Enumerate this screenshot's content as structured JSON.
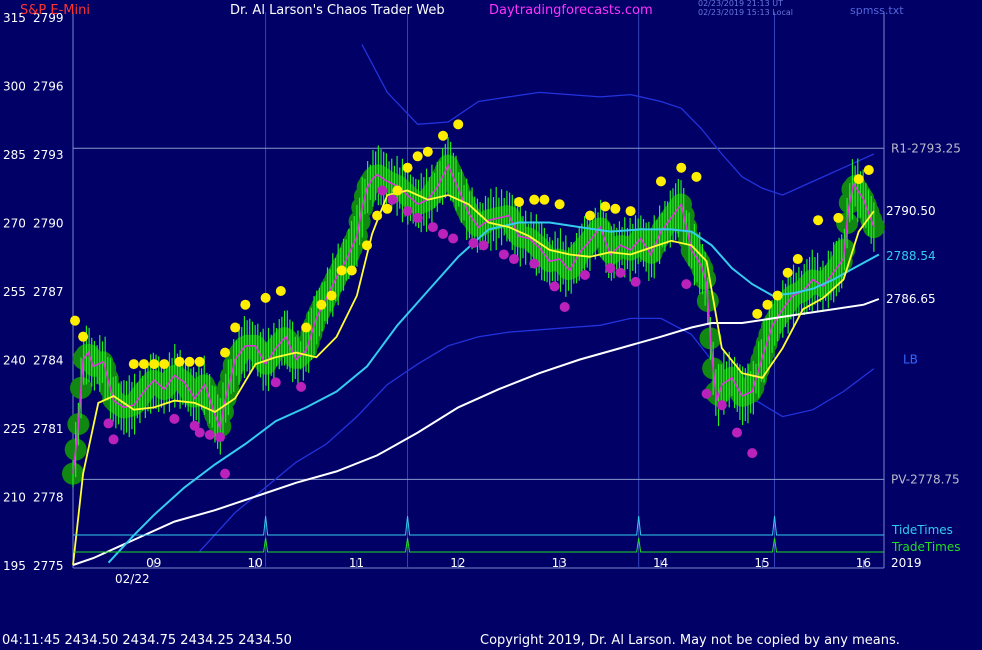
{
  "header": {
    "symbol_label": "S&P E-Mini",
    "title": "Dr. Al Larson's Chaos Trader Web",
    "site": "Daytradingforecasts.com",
    "stamp_ut": "02/23/2019 21:13 UT",
    "stamp_local": "02/23/2019 15:13 Local",
    "file": "spmss.txt"
  },
  "footer": {
    "quote": "04:11:45  2434.50  2434.75  2434.25  2434.50",
    "copyright": "Copyright 2019, Dr. Al Larson. May not be copied by any means."
  },
  "colors": {
    "background": "#000066",
    "price_bars": "#22ee22",
    "halo": "#118811",
    "price_smooth": "#ffff33",
    "cyan_avg": "#33ccee",
    "white_avg": "#ffffff",
    "channel": "#2233dd",
    "pivot_lines": "#8899cc",
    "highs_dots": "#ffee00",
    "lows_dots": "#bb22bb",
    "tide": "#33ccee",
    "trade": "#22dd22"
  },
  "chart_data": {
    "type": "line",
    "ylim": [
      2775,
      2799
    ],
    "left_axis": [
      {
        "idx": "315",
        "price": "2799",
        "value": 2799
      },
      {
        "idx": "300",
        "price": "2796",
        "value": 2796
      },
      {
        "idx": "285",
        "price": "2793",
        "value": 2793
      },
      {
        "idx": "270",
        "price": "2790",
        "value": 2790
      },
      {
        "idx": "255",
        "price": "2787",
        "value": 2787
      },
      {
        "idx": "240",
        "price": "2784",
        "value": 2784
      },
      {
        "idx": "225",
        "price": "2781",
        "value": 2781
      },
      {
        "idx": "210",
        "price": "2778",
        "value": 2778
      },
      {
        "idx": "195",
        "price": "2775",
        "value": 2775
      }
    ],
    "x_ticks": [
      {
        "label": "09",
        "hour": 9
      },
      {
        "label": "10",
        "hour": 10
      },
      {
        "label": "11",
        "hour": 11
      },
      {
        "label": "12",
        "hour": 12
      },
      {
        "label": "13",
        "hour": 13
      },
      {
        "label": "14",
        "hour": 14
      },
      {
        "label": "15",
        "hour": 15
      },
      {
        "label": "16",
        "hour": 16
      }
    ],
    "xlim": [
      8.2,
      16.2
    ],
    "date_label": "02/22",
    "year_label": "2019",
    "levels": [
      {
        "name": "R1-2793.25",
        "value": 2793.25
      },
      {
        "name": "PV-2778.75",
        "value": 2778.75
      }
    ],
    "value_labels": [
      {
        "text": "2790.50",
        "value": 2790.5
      },
      {
        "text": "2788.54",
        "value": 2788.54
      },
      {
        "text": "2786.65",
        "value": 2786.65
      },
      {
        "text": "LB",
        "value": 2784
      }
    ],
    "vertical_lines_hours": [
      10.1,
      11.5,
      13.78,
      15.12
    ],
    "tide_label": "TideTimes",
    "trade_label": "TradeTimes",
    "tide_spikes_hours": [
      10.1,
      11.5,
      13.78,
      15.12
    ],
    "series": [
      {
        "key": "price",
        "x": [
          8.2,
          8.25,
          8.3,
          8.35,
          8.4,
          8.5,
          8.6,
          8.7,
          8.8,
          8.9,
          9.0,
          9.1,
          9.2,
          9.3,
          9.4,
          9.5,
          9.6,
          9.65,
          9.7,
          9.8,
          9.9,
          10.0,
          10.1,
          10.2,
          10.3,
          10.4,
          10.5,
          10.6,
          10.7,
          10.8,
          10.9,
          11.0,
          11.05,
          11.1,
          11.15,
          11.2,
          11.3,
          11.4,
          11.5,
          11.6,
          11.7,
          11.8,
          11.9,
          12.0,
          12.1,
          12.2,
          12.3,
          12.4,
          12.5,
          12.6,
          12.7,
          12.8,
          12.9,
          13.0,
          13.1,
          13.2,
          13.3,
          13.4,
          13.5,
          13.6,
          13.7,
          13.8,
          13.9,
          14.0,
          14.1,
          14.2,
          14.3,
          14.4,
          14.45,
          14.5,
          14.55,
          14.6,
          14.7,
          14.8,
          14.9,
          15.0,
          15.1,
          15.2,
          15.3,
          15.4,
          15.5,
          15.6,
          15.7,
          15.8,
          15.85,
          15.9,
          16.0,
          16.1
        ],
        "values": [
          2779,
          2781,
          2784,
          2784.3,
          2783.7,
          2783.9,
          2782.2,
          2781.9,
          2782.0,
          2782.6,
          2783.1,
          2782.7,
          2783.3,
          2783.0,
          2782.3,
          2782.9,
          2781.6,
          2781.0,
          2782.2,
          2784.0,
          2784.6,
          2784.6,
          2783.8,
          2784.5,
          2785.0,
          2784.0,
          2784.4,
          2785.8,
          2786.7,
          2787.6,
          2788.4,
          2789.4,
          2790.6,
          2791.5,
          2791.9,
          2792.1,
          2791.8,
          2791.6,
          2791.2,
          2790.8,
          2791.0,
          2791.6,
          2792.5,
          2791.5,
          2790.4,
          2789.8,
          2790.1,
          2790.2,
          2790.3,
          2789.4,
          2789.3,
          2788.9,
          2788.3,
          2788.4,
          2787.9,
          2788.7,
          2789.2,
          2789.8,
          2788.6,
          2789.0,
          2788.8,
          2789.3,
          2788.6,
          2789.6,
          2790.2,
          2790.8,
          2788.8,
          2788.1,
          2787.3,
          2784.2,
          2782.2,
          2782.9,
          2783.2,
          2782.4,
          2782.6,
          2784.1,
          2785.5,
          2786.2,
          2786.8,
          2787.0,
          2787.5,
          2787.2,
          2787.8,
          2788.4,
          2790.6,
          2791.7,
          2791.0,
          2789.8
        ]
      },
      {
        "key": "smooth",
        "x": [
          8.2,
          8.3,
          8.45,
          8.6,
          8.8,
          9.0,
          9.2,
          9.4,
          9.6,
          9.8,
          10.0,
          10.2,
          10.4,
          10.6,
          10.8,
          11.0,
          11.15,
          11.3,
          11.5,
          11.7,
          11.9,
          12.1,
          12.3,
          12.5,
          12.7,
          12.9,
          13.1,
          13.3,
          13.5,
          13.7,
          13.9,
          14.1,
          14.3,
          14.45,
          14.6,
          14.8,
          15.0,
          15.2,
          15.4,
          15.6,
          15.8,
          15.95,
          16.1
        ],
        "values": [
          2775,
          2779.0,
          2782.1,
          2782.4,
          2781.8,
          2781.9,
          2782.2,
          2782.1,
          2781.7,
          2782.3,
          2783.8,
          2784.1,
          2784.3,
          2784.1,
          2785.0,
          2786.8,
          2789.5,
          2791.2,
          2791.4,
          2791.0,
          2791.2,
          2790.8,
          2790.0,
          2789.8,
          2789.4,
          2788.8,
          2788.6,
          2788.5,
          2788.7,
          2788.6,
          2788.9,
          2789.2,
          2789.0,
          2788.3,
          2784.5,
          2783.4,
          2783.2,
          2784.5,
          2786.2,
          2786.7,
          2787.5,
          2789.6,
          2790.5
        ]
      },
      {
        "key": "cyan",
        "x": [
          8.55,
          8.8,
          9.0,
          9.3,
          9.6,
          9.9,
          10.2,
          10.5,
          10.8,
          11.1,
          11.4,
          11.7,
          12.0,
          12.3,
          12.6,
          12.9,
          13.2,
          13.5,
          13.8,
          14.1,
          14.3,
          14.5,
          14.7,
          14.9,
          15.1,
          15.3,
          15.5,
          15.7,
          15.9,
          16.15
        ],
        "values": [
          2775.1,
          2776.3,
          2777.2,
          2778.4,
          2779.4,
          2780.3,
          2781.3,
          2781.9,
          2782.6,
          2783.7,
          2785.5,
          2787.0,
          2788.5,
          2789.7,
          2790.0,
          2790.0,
          2789.8,
          2789.6,
          2789.7,
          2789.7,
          2789.6,
          2789.0,
          2788.0,
          2787.3,
          2786.8,
          2786.9,
          2787.1,
          2787.5,
          2788.0,
          2788.6
        ]
      },
      {
        "key": "white",
        "x": [
          8.2,
          8.4,
          8.8,
          9.2,
          9.6,
          10.0,
          10.4,
          10.8,
          11.2,
          11.6,
          12.0,
          12.4,
          12.8,
          13.2,
          13.6,
          14.0,
          14.3,
          14.5,
          14.8,
          15.1,
          15.4,
          15.7,
          16.0,
          16.15
        ],
        "values": [
          2775.0,
          2775.3,
          2776.1,
          2776.9,
          2777.4,
          2778.0,
          2778.6,
          2779.1,
          2779.8,
          2780.8,
          2781.9,
          2782.7,
          2783.4,
          2784.0,
          2784.5,
          2785.0,
          2785.4,
          2785.6,
          2785.6,
          2785.8,
          2786.0,
          2786.2,
          2786.4,
          2786.65
        ]
      },
      {
        "key": "band_upper",
        "x": [
          11.05,
          11.3,
          11.6,
          11.9,
          12.2,
          12.5,
          12.8,
          13.1,
          13.4,
          13.7,
          14.0,
          14.2,
          14.4,
          14.6,
          14.8,
          15.0,
          15.2,
          15.5,
          15.8,
          16.1
        ],
        "values": [
          2797.8,
          2795.7,
          2794.3,
          2794.4,
          2795.3,
          2795.5,
          2795.7,
          2795.6,
          2795.5,
          2795.6,
          2795.3,
          2795.0,
          2794.1,
          2793.0,
          2792.0,
          2791.5,
          2791.2,
          2791.8,
          2792.4,
          2793.0
        ]
      },
      {
        "key": "band_lower",
        "x": [
          9.45,
          9.8,
          10.1,
          10.4,
          10.7,
          11.0,
          11.3,
          11.6,
          11.9,
          12.2,
          12.5,
          12.8,
          13.1,
          13.4,
          13.7,
          14.0,
          14.3,
          14.6,
          14.9,
          15.2,
          15.5,
          15.8,
          16.1
        ],
        "values": [
          2775.6,
          2777.3,
          2778.4,
          2779.5,
          2780.3,
          2781.5,
          2782.9,
          2783.8,
          2784.6,
          2785.0,
          2785.2,
          2785.3,
          2785.4,
          2785.5,
          2785.8,
          2785.8,
          2785.1,
          2783.4,
          2782.3,
          2781.5,
          2781.8,
          2782.6,
          2783.6
        ]
      }
    ],
    "highs": [
      [
        8.22,
        2785.7
      ],
      [
        8.3,
        2785.0
      ],
      [
        8.8,
        2783.8
      ],
      [
        8.9,
        2783.8
      ],
      [
        9.0,
        2783.8
      ],
      [
        9.1,
        2783.8
      ],
      [
        9.25,
        2783.9
      ],
      [
        9.35,
        2783.9
      ],
      [
        9.45,
        2783.9
      ],
      [
        9.7,
        2784.3
      ],
      [
        9.8,
        2785.4
      ],
      [
        9.9,
        2786.4
      ],
      [
        10.1,
        2786.7
      ],
      [
        10.25,
        2787.0
      ],
      [
        10.5,
        2785.4
      ],
      [
        10.65,
        2786.4
      ],
      [
        10.75,
        2786.8
      ],
      [
        10.85,
        2787.9
      ],
      [
        10.95,
        2787.9
      ],
      [
        11.1,
        2789.0
      ],
      [
        11.2,
        2790.3
      ],
      [
        11.3,
        2790.6
      ],
      [
        11.4,
        2791.4
      ],
      [
        11.5,
        2792.4
      ],
      [
        11.6,
        2792.9
      ],
      [
        11.7,
        2793.1
      ],
      [
        11.85,
        2793.8
      ],
      [
        12.0,
        2794.3
      ],
      [
        12.6,
        2790.9
      ],
      [
        12.75,
        2791.0
      ],
      [
        12.85,
        2791.0
      ],
      [
        13.0,
        2790.8
      ],
      [
        13.3,
        2790.3
      ],
      [
        13.45,
        2790.7
      ],
      [
        13.55,
        2790.6
      ],
      [
        13.7,
        2790.5
      ],
      [
        14.0,
        2791.8
      ],
      [
        14.2,
        2792.4
      ],
      [
        14.35,
        2792.0
      ],
      [
        14.95,
        2786.0
      ],
      [
        15.05,
        2786.4
      ],
      [
        15.15,
        2786.8
      ],
      [
        15.25,
        2787.8
      ],
      [
        15.35,
        2788.4
      ],
      [
        15.55,
        2790.1
      ],
      [
        15.75,
        2790.2
      ],
      [
        15.95,
        2791.9
      ],
      [
        16.05,
        2792.3
      ]
    ],
    "lows": [
      [
        8.55,
        2781.2
      ],
      [
        8.6,
        2780.5
      ],
      [
        9.2,
        2781.4
      ],
      [
        9.4,
        2781.1
      ],
      [
        9.45,
        2780.8
      ],
      [
        9.55,
        2780.7
      ],
      [
        9.65,
        2780.6
      ],
      [
        9.7,
        2779.0
      ],
      [
        10.2,
        2783.0
      ],
      [
        10.45,
        2782.8
      ],
      [
        11.25,
        2791.4
      ],
      [
        11.35,
        2791.0
      ],
      [
        11.5,
        2790.5
      ],
      [
        11.6,
        2790.2
      ],
      [
        11.75,
        2789.8
      ],
      [
        11.85,
        2789.5
      ],
      [
        11.95,
        2789.3
      ],
      [
        12.15,
        2789.1
      ],
      [
        12.25,
        2789.0
      ],
      [
        12.45,
        2788.6
      ],
      [
        12.55,
        2788.4
      ],
      [
        12.75,
        2788.2
      ],
      [
        12.95,
        2787.2
      ],
      [
        13.05,
        2786.3
      ],
      [
        13.25,
        2787.7
      ],
      [
        13.5,
        2788.0
      ],
      [
        13.6,
        2787.8
      ],
      [
        13.75,
        2787.4
      ],
      [
        14.25,
        2787.3
      ],
      [
        14.45,
        2782.5
      ],
      [
        14.6,
        2782.0
      ],
      [
        14.75,
        2780.8
      ],
      [
        14.9,
        2779.9
      ]
    ]
  }
}
